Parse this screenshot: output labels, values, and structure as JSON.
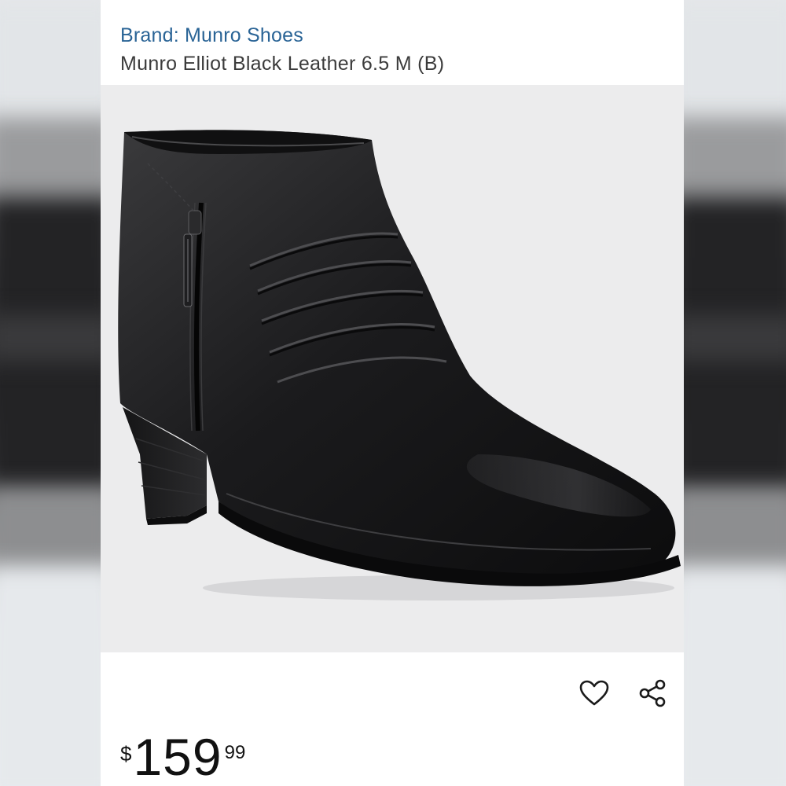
{
  "product": {
    "brand": "Brand: Munro Shoes",
    "title": "Munro Elliot Black Leather 6.5 M (B)",
    "image_alt": "black leather ankle boot with side zipper and block heel"
  },
  "price": {
    "symbol": "$",
    "whole": "159",
    "fraction": "99"
  },
  "actions": {
    "wishlist_icon": "heart-outline-icon",
    "share_icon": "share-icon"
  },
  "colors": {
    "brand_link": "#2a6496",
    "title_text": "#3b3b3b",
    "image_bg": "#ececed"
  }
}
